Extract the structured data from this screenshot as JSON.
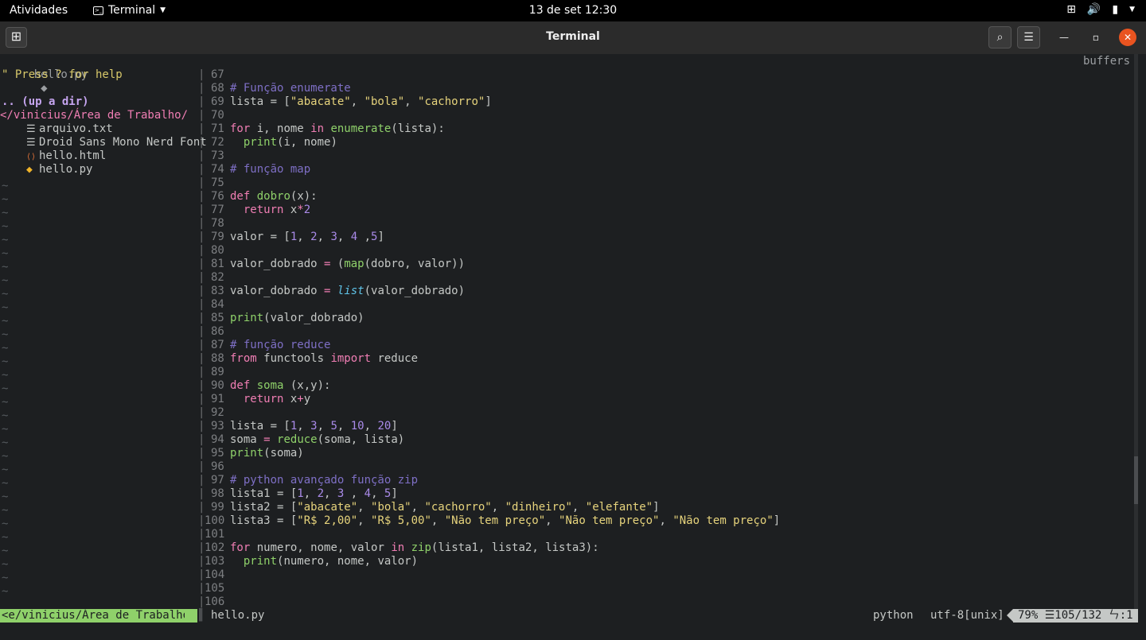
{
  "topbar": {
    "activities": "Atividades",
    "app_name": "Terminal",
    "clock": "13 de set  12:30",
    "tray_icons": [
      "network-icon",
      "volume-icon",
      "battery-icon",
      "power-caret-icon"
    ]
  },
  "window": {
    "title": "Terminal",
    "new_tab_icon": "new-tab-icon",
    "search_icon": "search-icon",
    "menu_icon": "hamburger-menu-icon"
  },
  "colors": {
    "keyword": "#f07eb4",
    "function": "#8fd16a",
    "string": "#e6d37c",
    "number": "#a98ae8",
    "comment": "#7e6fc5",
    "builtin": "#5fc2e6",
    "background": "#1d1f21",
    "accent_close": "#e95420"
  },
  "tabline": {
    "current_file": "hello.py",
    "file_icon": "python-icon",
    "buffers_label": "buffers"
  },
  "nerdtree": {
    "help_line": "\" Press ? for help",
    "up_dir": ".. (up a dir)",
    "cwd": "</vinicius/Área de Trabalho/",
    "entries": [
      {
        "icon": "text-file-icon",
        "name": "arquivo.txt"
      },
      {
        "icon": "text-file-icon",
        "name": "Droid Sans Mono Nerd Font"
      },
      {
        "icon": "html-file-icon",
        "name": "hello.html"
      },
      {
        "icon": "python-file-icon",
        "name": "hello.py"
      }
    ]
  },
  "editor": {
    "lines": [
      {
        "n": "67",
        "code": []
      },
      {
        "n": "68",
        "code": [
          [
            "cm",
            "# Função enumerate"
          ]
        ]
      },
      {
        "n": "69",
        "code": [
          [
            "",
            "lista = ["
          ],
          [
            "str",
            "\"abacate\""
          ],
          [
            "",
            ", "
          ],
          [
            "str",
            "\"bola\""
          ],
          [
            "",
            ", "
          ],
          [
            "str",
            "\"cachorro\""
          ],
          [
            "",
            "]"
          ]
        ]
      },
      {
        "n": "70",
        "code": []
      },
      {
        "n": "71",
        "code": [
          [
            "kw",
            "for"
          ],
          [
            "",
            " i, nome "
          ],
          [
            "kw",
            "in"
          ],
          [
            "",
            " "
          ],
          [
            "fn",
            "enumerate"
          ],
          [
            "",
            "(lista):"
          ]
        ]
      },
      {
        "n": "72",
        "code": [
          [
            "",
            "  "
          ],
          [
            "fn",
            "print"
          ],
          [
            "",
            "(i, nome)"
          ]
        ]
      },
      {
        "n": "73",
        "code": []
      },
      {
        "n": "74",
        "code": [
          [
            "cm",
            "# função map"
          ]
        ]
      },
      {
        "n": "75",
        "code": []
      },
      {
        "n": "76",
        "code": [
          [
            "kw",
            "def"
          ],
          [
            "",
            " "
          ],
          [
            "fn",
            "dobro"
          ],
          [
            "",
            "(x):"
          ]
        ]
      },
      {
        "n": "77",
        "code": [
          [
            "",
            "  "
          ],
          [
            "kw",
            "return"
          ],
          [
            "",
            " x"
          ],
          [
            "op",
            "*"
          ],
          [
            "num",
            "2"
          ]
        ]
      },
      {
        "n": "78",
        "code": []
      },
      {
        "n": "79",
        "code": [
          [
            "",
            "valor = ["
          ],
          [
            "num",
            "1"
          ],
          [
            "",
            ", "
          ],
          [
            "num",
            "2"
          ],
          [
            "",
            ", "
          ],
          [
            "num",
            "3"
          ],
          [
            "",
            ", "
          ],
          [
            "num",
            "4"
          ],
          [
            "",
            " ,"
          ],
          [
            "num",
            "5"
          ],
          [
            "",
            "]"
          ]
        ]
      },
      {
        "n": "80",
        "code": []
      },
      {
        "n": "81",
        "code": [
          [
            "",
            "valor_dobrado "
          ],
          [
            "op",
            "="
          ],
          [
            "",
            " ("
          ],
          [
            "fn",
            "map"
          ],
          [
            "",
            "(dobro, valor))"
          ]
        ]
      },
      {
        "n": "82",
        "code": []
      },
      {
        "n": "83",
        "code": [
          [
            "",
            "valor_dobrado "
          ],
          [
            "op",
            "="
          ],
          [
            "",
            " "
          ],
          [
            "bi",
            "list"
          ],
          [
            "",
            "(valor_dobrado)"
          ]
        ]
      },
      {
        "n": "84",
        "code": []
      },
      {
        "n": "85",
        "code": [
          [
            "fn",
            "print"
          ],
          [
            "",
            "(valor_dobrado)"
          ]
        ]
      },
      {
        "n": "86",
        "code": []
      },
      {
        "n": "87",
        "code": [
          [
            "cm",
            "# função reduce"
          ]
        ]
      },
      {
        "n": "88",
        "code": [
          [
            "kw",
            "from"
          ],
          [
            "",
            " functools "
          ],
          [
            "kw",
            "import"
          ],
          [
            "",
            " reduce"
          ]
        ]
      },
      {
        "n": "89",
        "code": []
      },
      {
        "n": "90",
        "code": [
          [
            "kw",
            "def"
          ],
          [
            "",
            " "
          ],
          [
            "fn",
            "soma"
          ],
          [
            "",
            " (x,y):"
          ]
        ]
      },
      {
        "n": "91",
        "code": [
          [
            "",
            "  "
          ],
          [
            "kw",
            "return"
          ],
          [
            "",
            " x"
          ],
          [
            "op",
            "+"
          ],
          [
            "",
            "y"
          ]
        ]
      },
      {
        "n": "92",
        "code": []
      },
      {
        "n": "93",
        "code": [
          [
            "",
            "lista = ["
          ],
          [
            "num",
            "1"
          ],
          [
            "",
            ", "
          ],
          [
            "num",
            "3"
          ],
          [
            "",
            ", "
          ],
          [
            "num",
            "5"
          ],
          [
            "",
            ", "
          ],
          [
            "num",
            "10"
          ],
          [
            "",
            ", "
          ],
          [
            "num",
            "20"
          ],
          [
            "",
            "]"
          ]
        ]
      },
      {
        "n": "94",
        "code": [
          [
            "",
            "soma "
          ],
          [
            "op",
            "="
          ],
          [
            "",
            " "
          ],
          [
            "fn",
            "reduce"
          ],
          [
            "",
            "(soma, lista)"
          ]
        ]
      },
      {
        "n": "95",
        "code": [
          [
            "fn",
            "print"
          ],
          [
            "",
            "(soma)"
          ]
        ]
      },
      {
        "n": "96",
        "code": []
      },
      {
        "n": "97",
        "code": [
          [
            "cm",
            "# python avançado função zip"
          ]
        ]
      },
      {
        "n": "98",
        "code": [
          [
            "",
            "lista1 = ["
          ],
          [
            "num",
            "1"
          ],
          [
            "",
            ", "
          ],
          [
            "num",
            "2"
          ],
          [
            "",
            ", "
          ],
          [
            "num",
            "3"
          ],
          [
            "",
            " , "
          ],
          [
            "num",
            "4"
          ],
          [
            "",
            ", "
          ],
          [
            "num",
            "5"
          ],
          [
            "",
            "]"
          ]
        ]
      },
      {
        "n": "99",
        "code": [
          [
            "",
            "lista2 = ["
          ],
          [
            "str",
            "\"abacate\""
          ],
          [
            "",
            ", "
          ],
          [
            "str",
            "\"bola\""
          ],
          [
            "",
            ", "
          ],
          [
            "str",
            "\"cachorro\""
          ],
          [
            "",
            ", "
          ],
          [
            "str",
            "\"dinheiro\""
          ],
          [
            "",
            ", "
          ],
          [
            "str",
            "\"elefante\""
          ],
          [
            "",
            "]"
          ]
        ]
      },
      {
        "n": "100",
        "code": [
          [
            "",
            "lista3 = ["
          ],
          [
            "str",
            "\"R$ 2,00\""
          ],
          [
            "",
            ", "
          ],
          [
            "str",
            "\"R$ 5,00\""
          ],
          [
            "",
            ", "
          ],
          [
            "str",
            "\"Não tem preço\""
          ],
          [
            "",
            ", "
          ],
          [
            "str",
            "\"Não tem preço\""
          ],
          [
            "",
            ", "
          ],
          [
            "str",
            "\"Não tem preço\""
          ],
          [
            "",
            "]"
          ]
        ]
      },
      {
        "n": "101",
        "code": []
      },
      {
        "n": "102",
        "code": [
          [
            "kw",
            "for"
          ],
          [
            "",
            " numero, nome, valor "
          ],
          [
            "kw",
            "in"
          ],
          [
            "",
            " "
          ],
          [
            "fn",
            "zip"
          ],
          [
            "",
            "(lista1, lista2, lista3):"
          ]
        ]
      },
      {
        "n": "103",
        "code": [
          [
            "",
            "  "
          ],
          [
            "fn",
            "print"
          ],
          [
            "",
            "(numero, nome, valor)"
          ]
        ]
      },
      {
        "n": "104",
        "code": []
      },
      {
        "n": "105",
        "code": []
      },
      {
        "n": "106",
        "code": []
      }
    ]
  },
  "statusline": {
    "tree_path": "<e/vinicius/Área de Trabalho",
    "filename": "hello.py",
    "filetype": "python",
    "encoding": "utf-8[unix]",
    "percent": "79%",
    "line_icon": "lines-icon",
    "line_pos": "105/132",
    "col_icon": "column-icon",
    "col_pos": ":1",
    "scroll_fraction": 0.79
  }
}
